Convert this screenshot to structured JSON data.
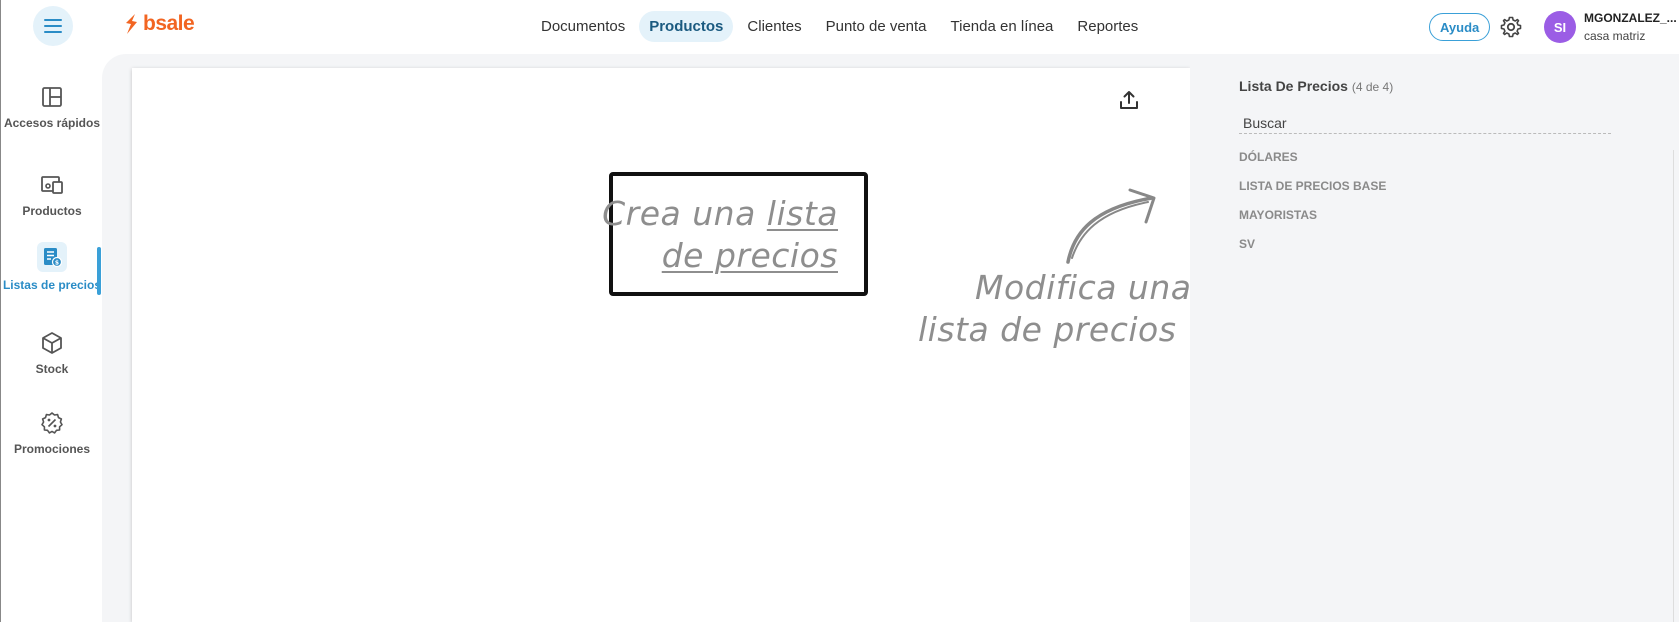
{
  "header": {
    "logo_text": "bsale",
    "nav": [
      "Documentos",
      "Productos",
      "Clientes",
      "Punto de venta",
      "Tienda en línea",
      "Reportes"
    ],
    "active_nav": "Productos",
    "help_label": "Ayuda",
    "avatar_initials": "SI",
    "user_name": "MGONZALEZ_...",
    "user_branch": "casa matriz"
  },
  "sidebar": {
    "items": [
      {
        "label": "Accesos rápidos",
        "icon": "layout-icon"
      },
      {
        "label": "Productos",
        "icon": "devices-icon"
      },
      {
        "label": "Listas de precios",
        "icon": "price-list-icon",
        "active": true
      },
      {
        "label": "Stock",
        "icon": "box-icon"
      },
      {
        "label": "Promociones",
        "icon": "discount-badge-icon"
      }
    ]
  },
  "canvas": {
    "create_line1_a": "Crea una ",
    "create_line1_b": "lista",
    "create_line2": "de precios",
    "modify_line1": "Modifica una",
    "modify_line2": "lista de precios",
    "upload_icon": "upload-icon"
  },
  "right_panel": {
    "title": "Lista De Precios",
    "count": "(4 de 4)",
    "search_placeholder": "Buscar",
    "items": [
      "DÓLARES",
      "LISTA DE PRECIOS BASE",
      "MAYORISTAS",
      "SV"
    ]
  },
  "colors": {
    "brand": "#f26522",
    "accent": "#2a8cc6",
    "avatar": "#9b5de5"
  }
}
